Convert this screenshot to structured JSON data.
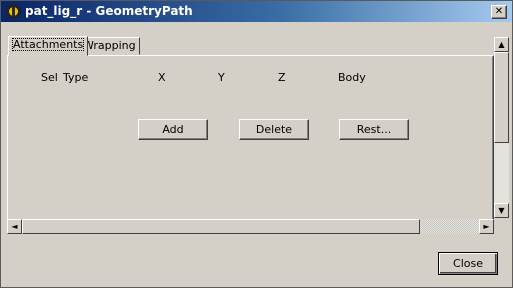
{
  "window": {
    "title": "pat_lig_r - GeometryPath",
    "close_glyph": "✕"
  },
  "tabs": [
    {
      "label": "Attachments",
      "active": true
    },
    {
      "label": "Wrapping",
      "active": false
    }
  ],
  "table": {
    "columns": [
      "Sel",
      "Type",
      "X",
      "Y",
      "Z",
      "Body"
    ]
  },
  "buttons": {
    "add": "Add",
    "delete": "Delete",
    "rest": "Rest...",
    "close": "Close"
  },
  "scroll": {
    "up": "▲",
    "down": "▼",
    "left": "◄",
    "right": "►"
  }
}
